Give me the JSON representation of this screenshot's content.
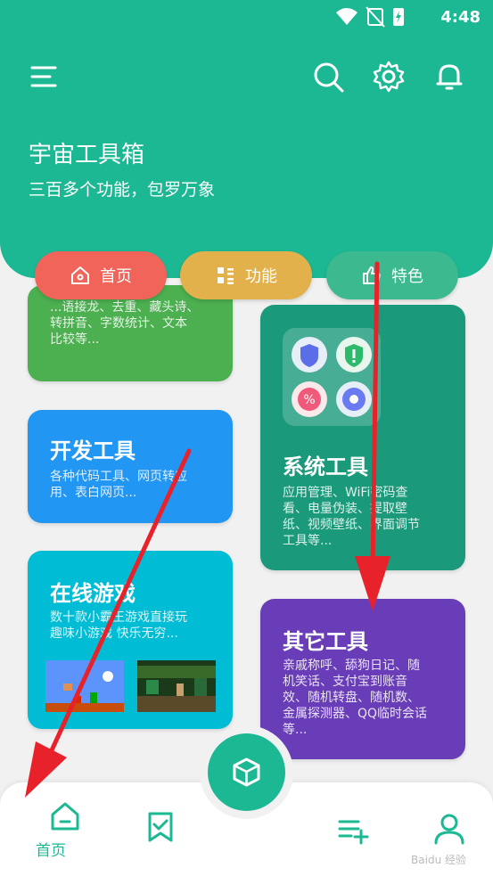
{
  "status_bar": {
    "time": "4:48"
  },
  "header": {
    "title": "宇宙工具箱",
    "subtitle": "三百多个功能，包罗万象"
  },
  "pills": [
    {
      "label": "首页",
      "color": "#f0645a",
      "icon": "home-icon"
    },
    {
      "label": "功能",
      "color": "#e3b14b",
      "icon": "grid-icon"
    },
    {
      "label": "特色",
      "color": "#3cb98f",
      "icon": "thumbs-up-icon"
    }
  ],
  "cards": {
    "text_tools": {
      "desc1": "...语接龙、去重、藏头诗、",
      "desc2": "转拼音、字数统计、文本",
      "desc3": "比较等...",
      "color": "#4caf50"
    },
    "dev_tools": {
      "title": "开发工具",
      "desc1": "各种代码工具、网页转应",
      "desc2": "用、表白网页...",
      "color": "#2196f3"
    },
    "online_games": {
      "title": "在线游戏",
      "desc1": "数十款小霸王游戏直接玩",
      "desc2": "趣味小游戏 快乐无穷...",
      "color": "#00bcd4"
    },
    "system_tools": {
      "title": "系统工具",
      "desc1": "应用管理、WiFi密码查",
      "desc2": "看、电量伪装、提取壁",
      "desc3": "纸、视频壁纸、界面调节",
      "desc4": "工具等...",
      "color": "#1a9a7b"
    },
    "other_tools": {
      "title": "其它工具",
      "desc1": "亲戚称呼、舔狗日记、随",
      "desc2": "机笑话、支付宝到账音",
      "desc3": "效、随机转盘、随机数、",
      "desc4": "金属探测器、QQ临时会话",
      "desc5": "等...",
      "color": "#6a3db8"
    }
  },
  "bottom_nav": {
    "home_label": "首页"
  },
  "watermark": "Baidu 经验"
}
